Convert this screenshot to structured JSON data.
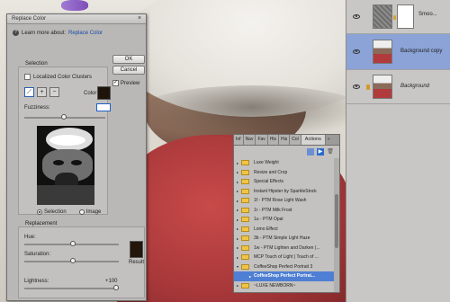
{
  "dialog": {
    "title": "Replace Color",
    "learn_more_prefix": "Learn more about:",
    "learn_more_link": "Replace Color",
    "ok_label": "OK",
    "cancel_label": "Cancel",
    "preview_label": "Preview",
    "preview_checked": true,
    "selection_label": "Selection",
    "localized_label": "Localized Color Clusters",
    "localized_checked": false,
    "color_label": "Color:",
    "selected_color": "#1f1409",
    "fuzziness_label": "Fuzziness:",
    "fuzziness_value": "",
    "view_options": [
      {
        "label": "Selection",
        "selected": true
      },
      {
        "label": "Image",
        "selected": false
      }
    ],
    "replacement_label": "Replacement",
    "hue_label": "Hue:",
    "hue_value": "0",
    "saturation_label": "Saturation:",
    "saturation_value": "0",
    "lightness_label": "Lightness:",
    "lightness_value": "+100",
    "result_label": "Result",
    "result_color": "#23160b"
  },
  "layers": {
    "items": [
      {
        "name": "Smoo...",
        "visible": true,
        "thumb": "gray",
        "has_mask": true
      },
      {
        "name": "Background copy",
        "visible": true,
        "thumb": "photo",
        "selected": true
      },
      {
        "name": "Background",
        "visible": true,
        "thumb": "photo",
        "locked": true
      }
    ]
  },
  "actions": {
    "tabs": [
      "Inf",
      "Nav",
      "Fav",
      "His",
      "His",
      "Col",
      "Actions",
      "»"
    ],
    "active_tab": "Actions",
    "items": [
      "Luxe Weight",
      "Resize and Crop",
      "Special Effects",
      "Instant Hipster by SparkleStock",
      "1f - PTM Rose Light Wash",
      "1r - PTM Milk Frost",
      "1u - PTM Opal",
      "Lomo Effect",
      "3b - PTM Simple Light Haze",
      "1w - PTM Lighten and Darken (...",
      "MCP Touch of Light | Touch of ...",
      "CoffeeShop Perfect Portrait 3",
      "CoffeeShop Perfect Portrai...",
      "~LUXE NEWBORN~"
    ]
  }
}
